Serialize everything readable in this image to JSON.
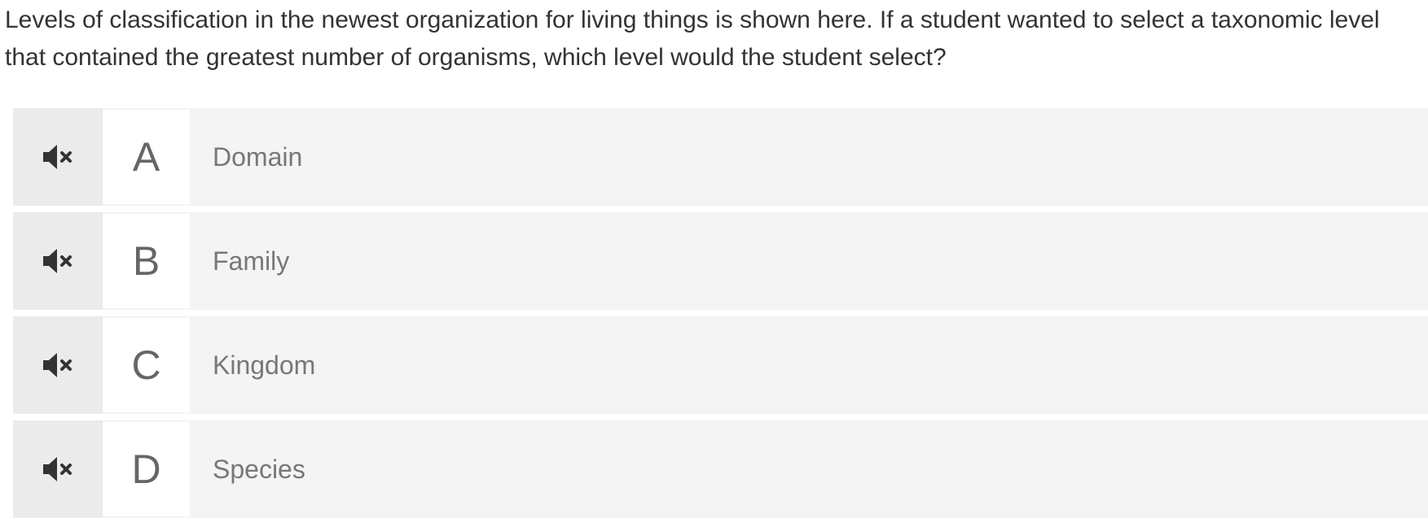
{
  "question": {
    "text": "Levels of classification in the newest organization for living things is shown here. If a student wanted to select a taxonomic level that contained the greatest number of organisms, which level would the student select?"
  },
  "choices": [
    {
      "letter": "A",
      "label": "Domain",
      "audio_icon": "speaker-mute-icon"
    },
    {
      "letter": "B",
      "label": "Family",
      "audio_icon": "speaker-mute-icon"
    },
    {
      "letter": "C",
      "label": "Kingdom",
      "audio_icon": "speaker-mute-icon"
    },
    {
      "letter": "D",
      "label": "Species",
      "audio_icon": "speaker-mute-icon"
    }
  ],
  "colors": {
    "question_text": "#333333",
    "choice_background": "#f4f4f4",
    "audio_button_background": "#ebebeb",
    "letter_box_background": "#ffffff",
    "choice_text": "#777777",
    "icon": "#333333"
  }
}
